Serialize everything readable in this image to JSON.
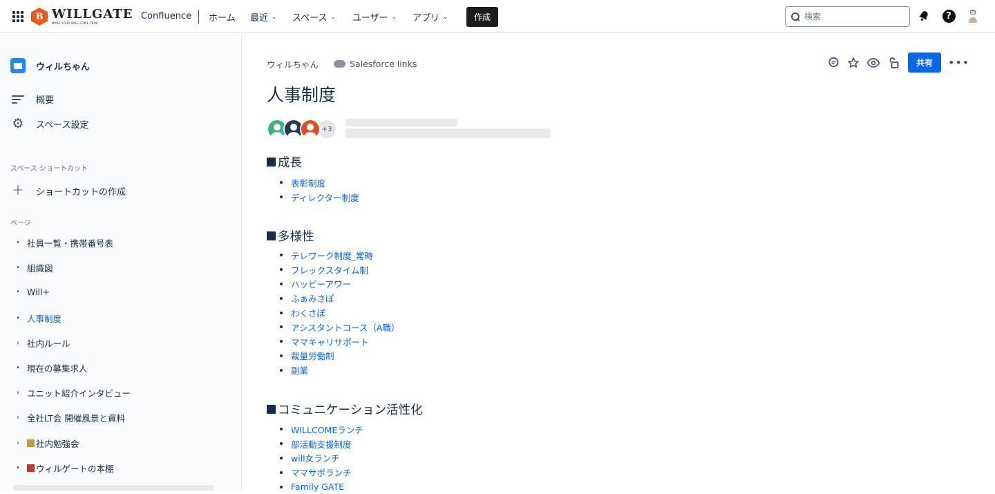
{
  "topnav": {
    "logo_mark": "B",
    "logo_name": "WILLGATE",
    "logo_tagline": "MAKE YOUR WILL COME TRUE",
    "product": "Confluence",
    "items": [
      {
        "label": "ホーム",
        "dropdown": false
      },
      {
        "label": "最近",
        "dropdown": true
      },
      {
        "label": "スペース",
        "dropdown": true
      },
      {
        "label": "ユーザー",
        "dropdown": true
      },
      {
        "label": "アプリ",
        "dropdown": true
      }
    ],
    "create_label": "作成",
    "search_placeholder": "検索",
    "help_glyph": "?"
  },
  "sidebar": {
    "space_name": "ウィルちゃん",
    "overview_label": "概要",
    "settings_label": "スペース設定",
    "shortcuts_header": "スペース ショートカット",
    "create_shortcut_label": "ショートカットの作成",
    "pages_header": "ページ",
    "pages": [
      {
        "label": "社員一覧・携帯番号表",
        "mark": "•",
        "active": false
      },
      {
        "label": "組織図",
        "mark": "•",
        "active": false
      },
      {
        "label": "Will+",
        "mark": "•",
        "active": false
      },
      {
        "label": "人事制度",
        "mark": "•",
        "active": true
      },
      {
        "label": "社内ルール",
        "mark": "›",
        "active": false
      },
      {
        "label": "現在の募集求人",
        "mark": "•",
        "active": false
      },
      {
        "label": "ユニット紹介インタビュー",
        "mark": "›",
        "active": false
      },
      {
        "label": "全社LT会 開催風景と資料",
        "mark": "›",
        "active": false
      },
      {
        "label": "社内勉強会",
        "mark": "›",
        "active": false,
        "emoji_color": "#c49a3a"
      },
      {
        "label": "ウィルゲートの本棚",
        "mark": "•",
        "active": false,
        "emoji_color": "#c0392b"
      }
    ]
  },
  "main": {
    "breadcrumb_space": "ウィルちゃん",
    "breadcrumb_link": "Salesforce links",
    "share_label": "共有",
    "title": "人事制度",
    "contributors_more": "+3",
    "sections": [
      {
        "heading": "成長",
        "items": [
          "表彰制度",
          "ディレクター制度"
        ]
      },
      {
        "heading": "多様性",
        "items": [
          "テレワーク制度_常時",
          "フレックスタイム制",
          "ハッピーアワー",
          "ふぁみさぽ",
          "わくさぽ",
          "アシスタントコース（A職）",
          "ママキャリサポート",
          "裁量労働制",
          "副業"
        ]
      },
      {
        "heading": "コミュニケーション活性化",
        "items": [
          "WILLCOMEランチ",
          "部活動支援制度",
          "will女ランチ",
          "ママサポランチ",
          "Family GATE"
        ]
      }
    ]
  },
  "colors": {
    "link": "#0c66e4",
    "share": "#0c66e4",
    "create": "#1d1d1d",
    "brand": "#e8591a",
    "text": "#172b4d"
  }
}
